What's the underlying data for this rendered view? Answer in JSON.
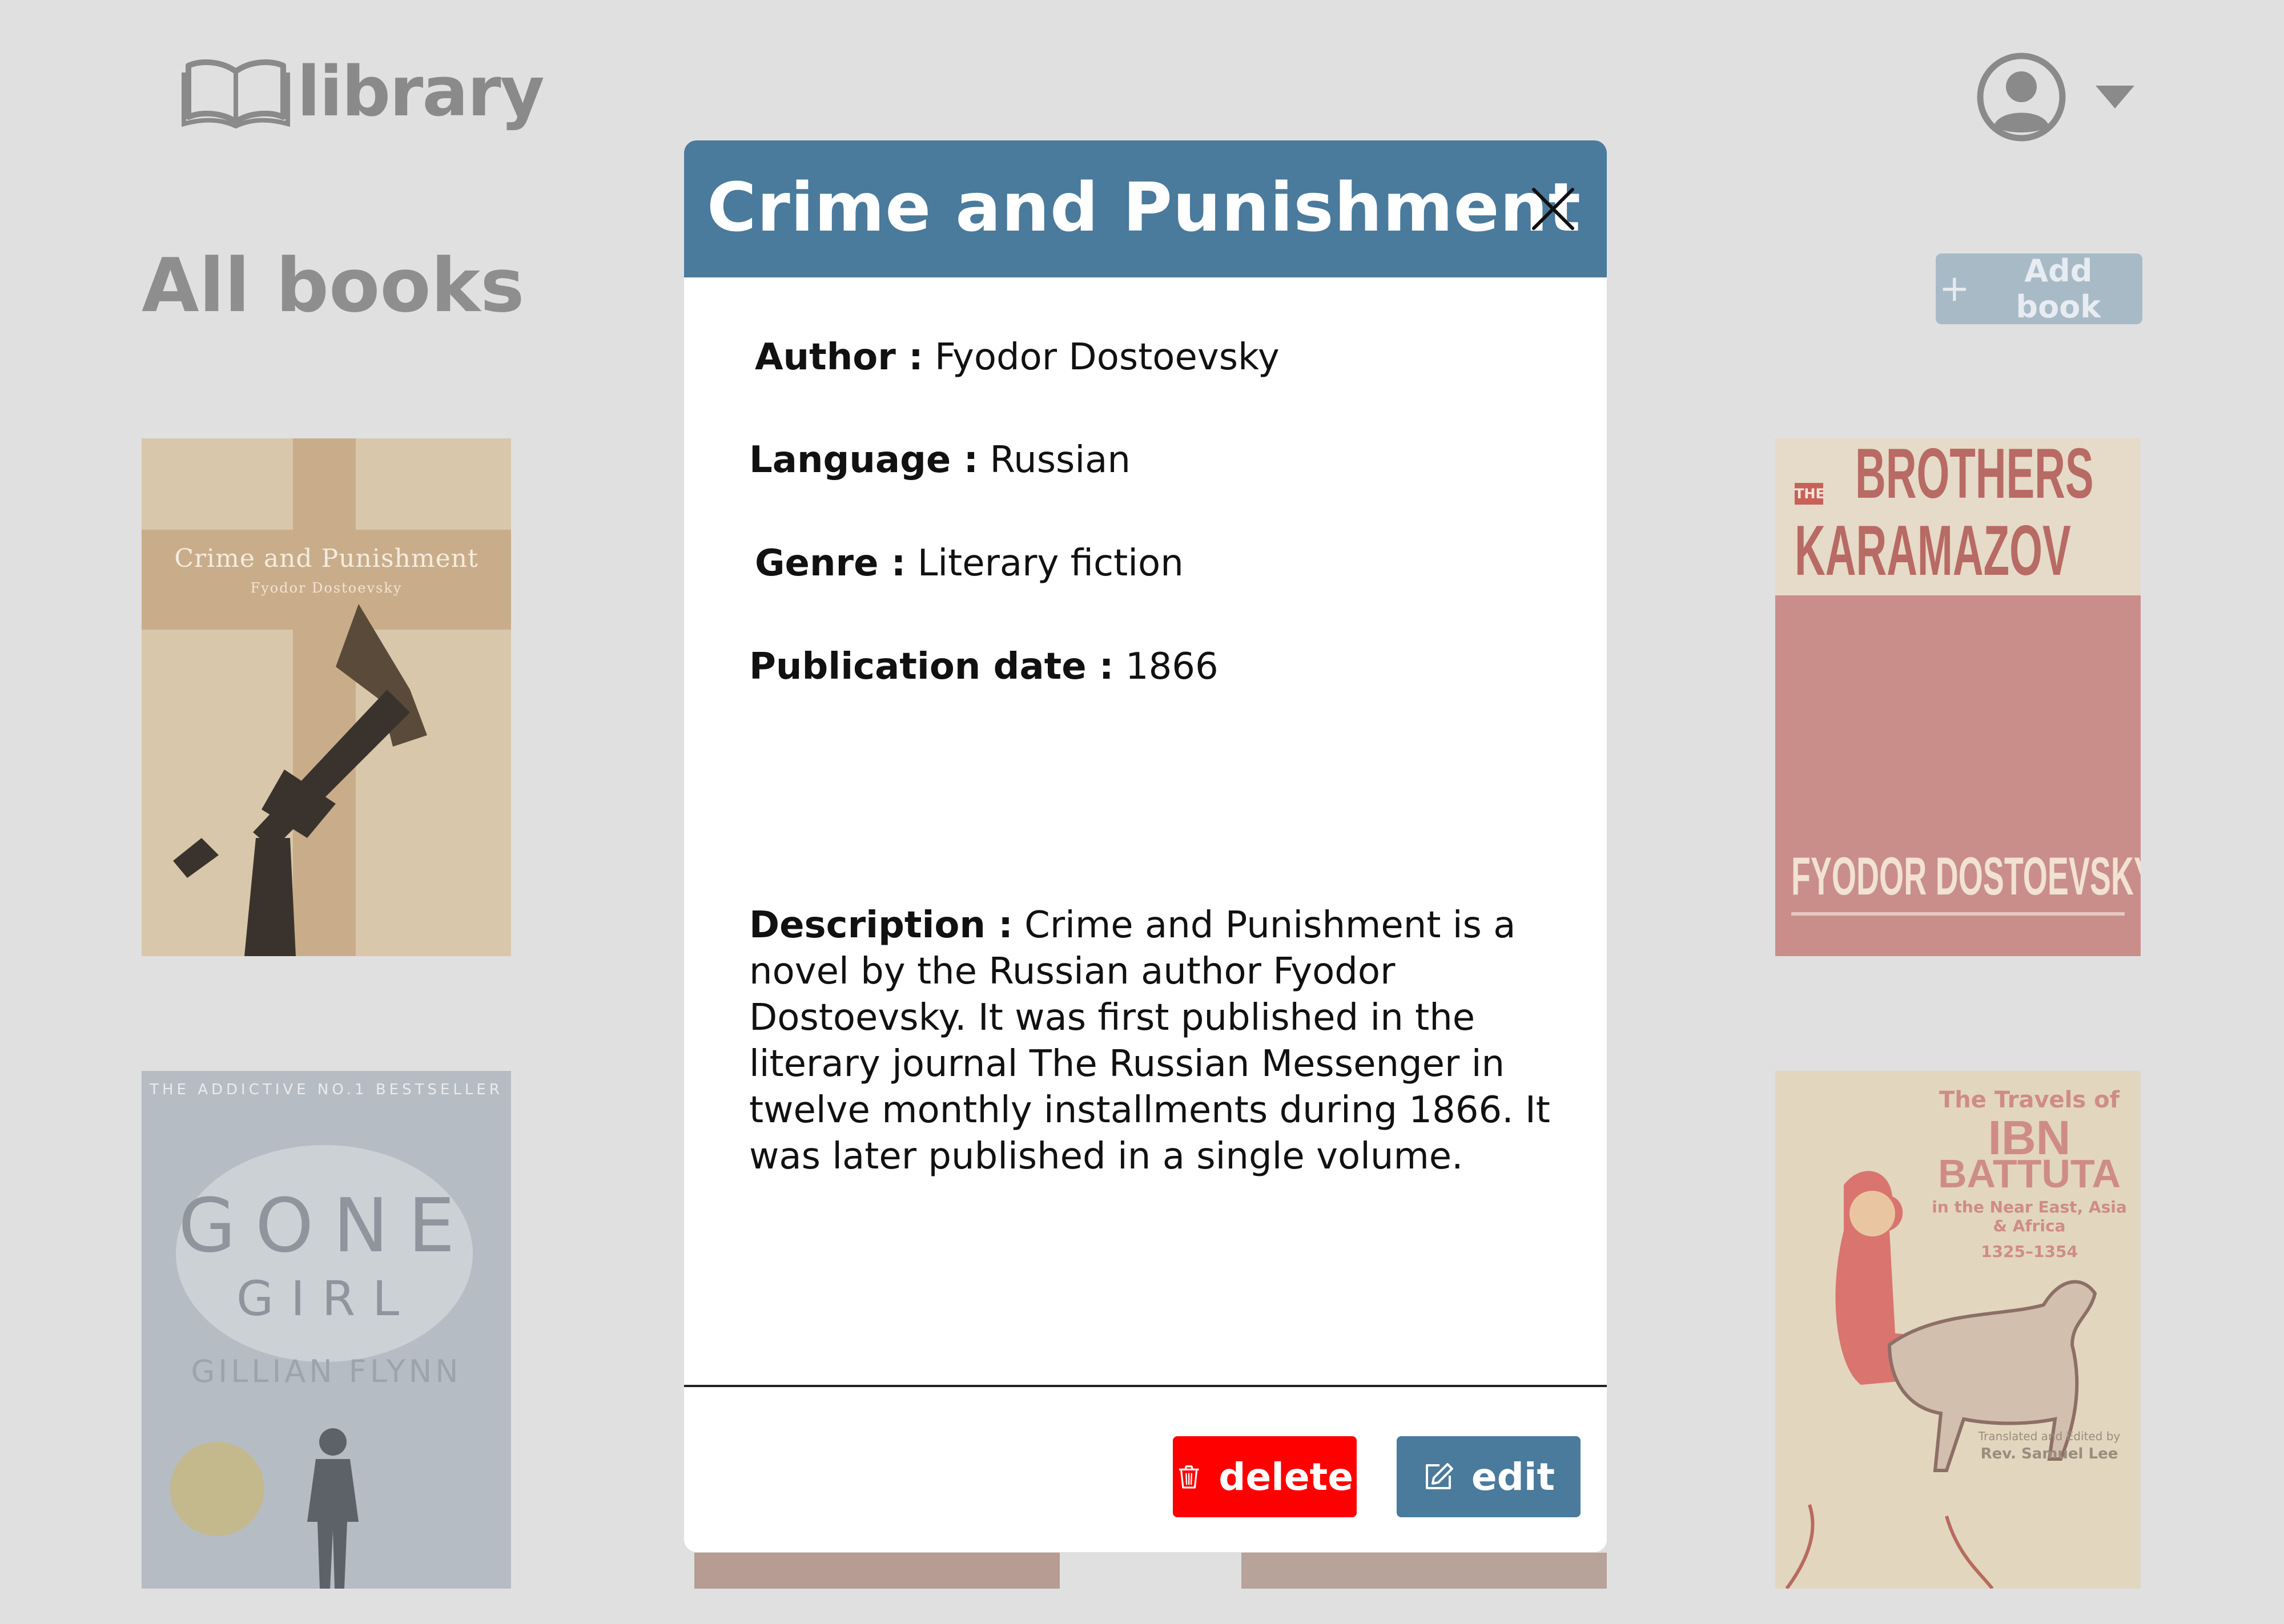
{
  "brand": {
    "name": "library"
  },
  "page": {
    "title": "All books",
    "add_book_label": "Add book"
  },
  "books": [
    {
      "title": "Crime and Punishment",
      "author": "Fyodor Dostoevsky"
    },
    {
      "title_small": "THE",
      "title": "BROTHERS",
      "title_line2": "KARAMAZOV",
      "author": "FYODOR DOSTOEVSKY"
    },
    {
      "tagline": "THE ADDICTIVE NO.1 BESTSELLER",
      "title": "GONE",
      "title_line2": "GIRL",
      "author": "GILLIAN FLYNN"
    },
    {
      "title_line1": "The Travels of",
      "title": "IBN",
      "title_line2": "BATTUTA",
      "subtitle": "in the Near East, Asia & Africa",
      "years": "1325–1354",
      "credit": "Translated and Edited by",
      "editor": "Rev. Samuel Lee"
    }
  ],
  "modal": {
    "title": "Crime and Punishment",
    "author_label": "Author :",
    "author": "Fyodor Dostoevsky",
    "language_label": "Language :",
    "language": "Russian",
    "genre_label": "Genre :",
    "genre": "Literary fiction",
    "date_label": "Publication date :",
    "date": "1866",
    "description_label": "Description :",
    "description": "Crime and Punishment is a novel by the Russian author Fyodor Dostoevsky. It was first published in the literary journal The Russian Messenger in twelve monthly installments during 1866. It was later published in a single volume.",
    "delete_label": "delete",
    "edit_label": "edit"
  },
  "icons": {
    "logo": "open-book-icon",
    "avatar": "user-circle-icon",
    "menu": "caret-down-icon",
    "close": "close-icon",
    "delete": "trash-icon",
    "edit": "edit-icon",
    "add": "plus-icon"
  },
  "colors": {
    "background": "#e0e0e0",
    "modal_header": "#4a7a9c",
    "delete_button": "#ff0000",
    "edit_button": "#4a7a9c",
    "add_button": "#a9bac7"
  }
}
